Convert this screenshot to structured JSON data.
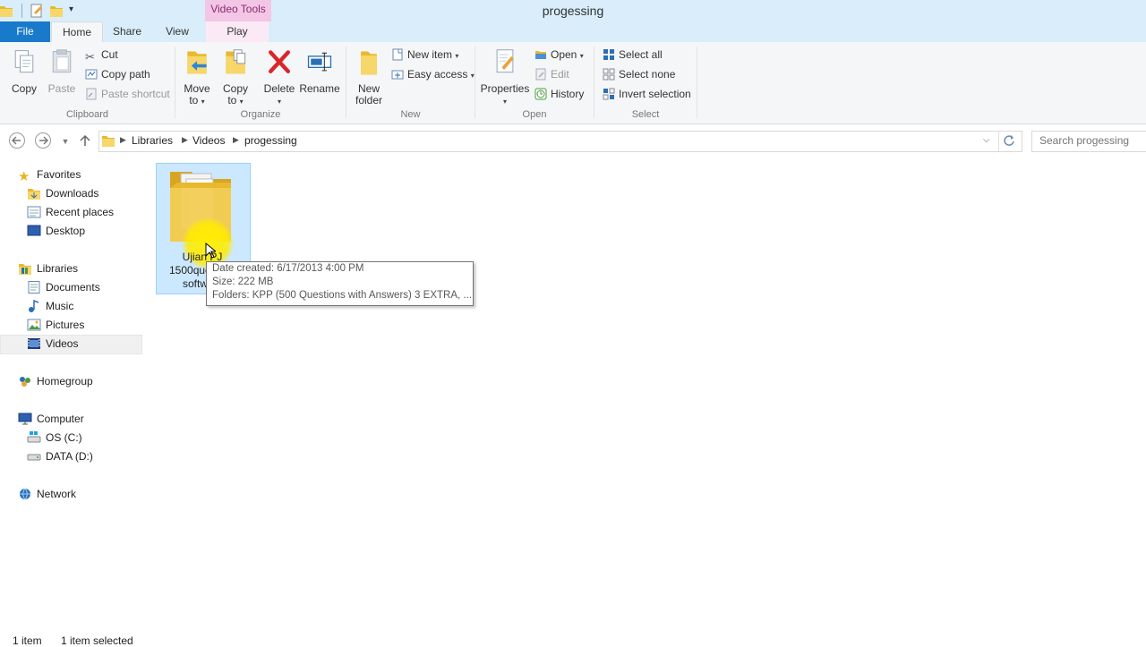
{
  "window": {
    "title": "progessing",
    "contextual_tab_group": "Video Tools"
  },
  "ribbon_tabs": [
    {
      "label": "File"
    },
    {
      "label": "Home"
    },
    {
      "label": "Share"
    },
    {
      "label": "View"
    },
    {
      "label": "Play"
    }
  ],
  "ribbon": {
    "clipboard": {
      "label": "Clipboard",
      "copy": "Copy",
      "paste": "Paste",
      "cut": "Cut",
      "copy_path": "Copy path",
      "paste_shortcut": "Paste shortcut"
    },
    "organize": {
      "label": "Organize",
      "move_to_1": "Move",
      "move_to_2": "to",
      "copy_to_1": "Copy",
      "copy_to_2": "to",
      "delete": "Delete",
      "rename": "Rename"
    },
    "new": {
      "label": "New",
      "new_folder_1": "New",
      "new_folder_2": "folder",
      "new_item": "New item",
      "easy_access": "Easy access"
    },
    "open": {
      "label": "Open",
      "properties": "Properties",
      "open": "Open",
      "edit": "Edit",
      "history": "History"
    },
    "select": {
      "label": "Select",
      "select_all": "Select all",
      "select_none": "Select none",
      "invert_selection": "Invert selection"
    }
  },
  "address": {
    "breadcrumbs": [
      "Libraries",
      "Videos",
      "progessing"
    ],
    "search_placeholder": "Search progessing"
  },
  "nav_pane": {
    "favorites": {
      "label": "Favorites",
      "items": [
        "Downloads",
        "Recent places",
        "Desktop"
      ]
    },
    "libraries": {
      "label": "Libraries",
      "items": [
        "Documents",
        "Music",
        "Pictures",
        "Videos"
      ]
    },
    "homegroup": "Homegroup",
    "computer": {
      "label": "Computer",
      "items": [
        "OS (C:)",
        "DATA (D:)"
      ]
    },
    "network": "Network"
  },
  "content": {
    "folder": {
      "name_line1": "Ujian PJ",
      "name_line2": "1500que",
      "name_line3": "softw"
    },
    "tooltip": {
      "date_created": "Date created: 6/17/2013 4:00 PM",
      "size": "Size: 222 MB",
      "folders": "Folders: KPP (500 Questions with Answers) 3 EXTRA, ..."
    }
  },
  "status_bar": {
    "item_count": "1 item",
    "selected": "1 item selected"
  },
  "colors": {
    "file_tab": "#1979ca",
    "title_bar": "#d9eefa",
    "selection": "#cce8ff",
    "contextual": "#f3c6e6"
  }
}
